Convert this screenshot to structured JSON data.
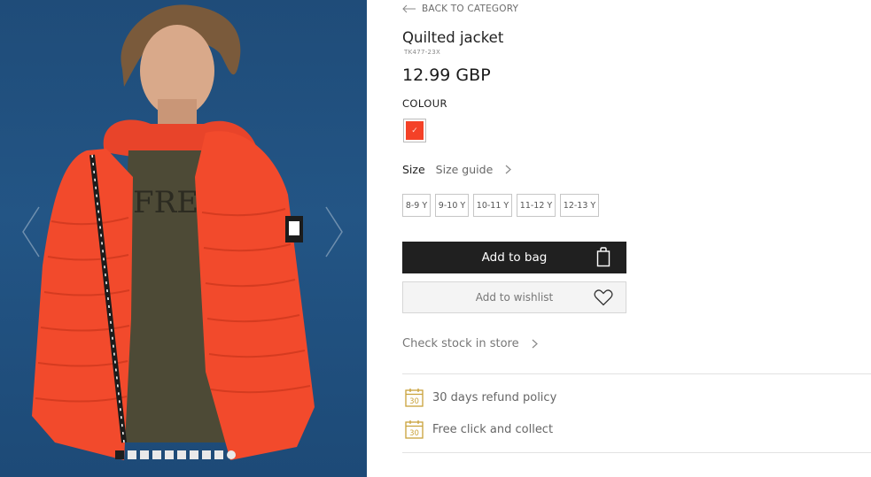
{
  "gallery": {
    "photo_alt": "Boy wearing red quilted jacket",
    "dots_total": 10,
    "active_dot": 0,
    "background_color": "#235585",
    "jacket_color": "#f24a2c"
  },
  "nav": {
    "back_label": "BACK TO CATEGORY"
  },
  "product": {
    "title": "Quilted jacket",
    "ref": "TK477-23X",
    "price": "12.99 GBP"
  },
  "colour": {
    "label": "COLOUR",
    "swatch_color": "#f44127",
    "check": "✓"
  },
  "size": {
    "label": "Size",
    "guide_label": "Size guide",
    "options": [
      "8-9 Y",
      "9-10 Y",
      "10-11 Y",
      "11-12 Y",
      "12-13 Y"
    ]
  },
  "actions": {
    "add_to_bag": "Add to bag",
    "add_to_wishlist": "Add to wishlist",
    "check_stock": "Check stock in store"
  },
  "features": {
    "calendar_number": "30",
    "refund": "30 days refund policy",
    "click_collect": "Free click and collect"
  },
  "colors": {
    "accent_gold": "#c9a23a",
    "button_dark": "#202020"
  }
}
